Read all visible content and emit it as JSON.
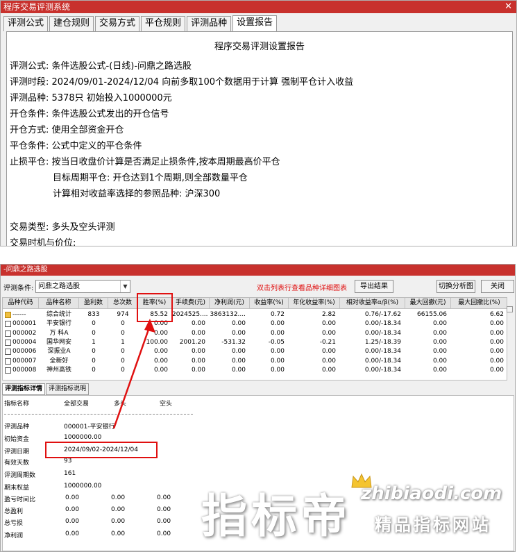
{
  "window1": {
    "title": "程序交易评测系统",
    "tabs": [
      "评测公式",
      "建仓规则",
      "交易方式",
      "平仓规则",
      "评测品种",
      "设置报告"
    ],
    "report": {
      "title": "程序交易评测设置报告",
      "lines": [
        "评测公式:  条件选股公式-(日线)-问鼎之路选股",
        "评测时段:  2024/09/01-2024/12/04 向前多取100个数据用于计算 强制平仓计入收益",
        "评测品种:  5378只 初始投入1000000元",
        "开仓条件:  条件选股公式发出的开仓信号",
        "开仓方式:  使用全部资金开仓",
        "平仓条件:  公式中定义的平仓条件",
        "止损平仓:  按当日收盘价计算是否满足止损条件,按本周期最高价平仓",
        "目标周期平仓:  开仓达到1个周期,则全部数量平仓",
        "计算相对收益率选择的参照品种:  沪深300",
        "交易类型:  多头及空头评测",
        "交易时机与价位:"
      ]
    }
  },
  "window2": {
    "title": "-问鼎之路选股",
    "condition_label": "评测条件:",
    "condition_value": "问鼎之路选股",
    "hint": "双击列表行查看品种详细图表",
    "export_label": "导出结果",
    "switch_label": "切换分析图",
    "close_label": "关闭",
    "columns": [
      "品种代码",
      "品种名称",
      "盈利数",
      "总次数",
      "胜率(%)",
      "手续费(元)",
      "净利润(元)",
      "收益率(%)",
      "年化收益率(%)",
      "相对收益率α/β(%)",
      "最大回撤(元)",
      "最大回撤比(%)"
    ],
    "rows": [
      [
        "------",
        "综合统计",
        "833",
        "974",
        "85.52",
        "2024525....",
        "3863132....",
        "0.72",
        "2.82",
        "0.76/-17.62",
        "66155.06",
        "6.62"
      ],
      [
        "000001",
        "平安银行",
        "0",
        "0",
        "0.00",
        "0.00",
        "0.00",
        "0.00",
        "0.00",
        "0.00/-18.34",
        "0.00",
        "0.00"
      ],
      [
        "000002",
        "万 科A",
        "0",
        "0",
        "0.00",
        "0.00",
        "0.00",
        "0.00",
        "0.00",
        "0.00/-18.34",
        "0.00",
        "0.00"
      ],
      [
        "000004",
        "国华网安",
        "1",
        "1",
        "100.00",
        "2001.20",
        "-531.32",
        "-0.05",
        "-0.21",
        "1.25/-18.39",
        "0.00",
        "0.00"
      ],
      [
        "000006",
        "深振业A",
        "0",
        "0",
        "0.00",
        "0.00",
        "0.00",
        "0.00",
        "0.00",
        "0.00/-18.34",
        "0.00",
        "0.00"
      ],
      [
        "000007",
        "全新好",
        "0",
        "0",
        "0.00",
        "0.00",
        "0.00",
        "0.00",
        "0.00",
        "0.00/-18.34",
        "0.00",
        "0.00"
      ],
      [
        "000008",
        "神州高铁",
        "0",
        "0",
        "0.00",
        "0.00",
        "0.00",
        "0.00",
        "0.00",
        "0.00/-18.34",
        "0.00",
        "0.00"
      ]
    ],
    "detail_tabs": [
      "评测指标详情",
      "评测指标说明"
    ],
    "detail_header": [
      "指标名称",
      "全部交易",
      "多头",
      "空头"
    ],
    "detail_rows": [
      {
        "name": "评测品种",
        "v1": "000001-平安银行"
      },
      {
        "name": "初始资金",
        "v1": "1000000.00"
      },
      {
        "name": "评测日期",
        "v1": "2024/09/02-2024/12/04"
      },
      {
        "name": "有效天数",
        "v1": "93"
      },
      {
        "name": "评测周期数",
        "v1": "161"
      },
      {
        "name": "期末权益",
        "v1": "1000000.00"
      },
      {
        "name": "盈亏时间比",
        "v1": "0.00",
        "v2": "0.00",
        "v3": "0.00"
      },
      {
        "name": "总盈利",
        "v1": "0.00",
        "v2": "0.00",
        "v3": "0.00"
      },
      {
        "name": "总亏损",
        "v1": "0.00",
        "v2": "0.00",
        "v3": "0.00"
      },
      {
        "name": "净利润",
        "v1": "0.00",
        "v2": "0.00",
        "v3": "0.00"
      }
    ]
  },
  "watermark": {
    "chars": "指标帝",
    "site": "zhibiaodi.com",
    "slogan": "精品指标网站"
  },
  "colors": {
    "title_bar": "#c8312d",
    "highlight": "#e01010"
  }
}
